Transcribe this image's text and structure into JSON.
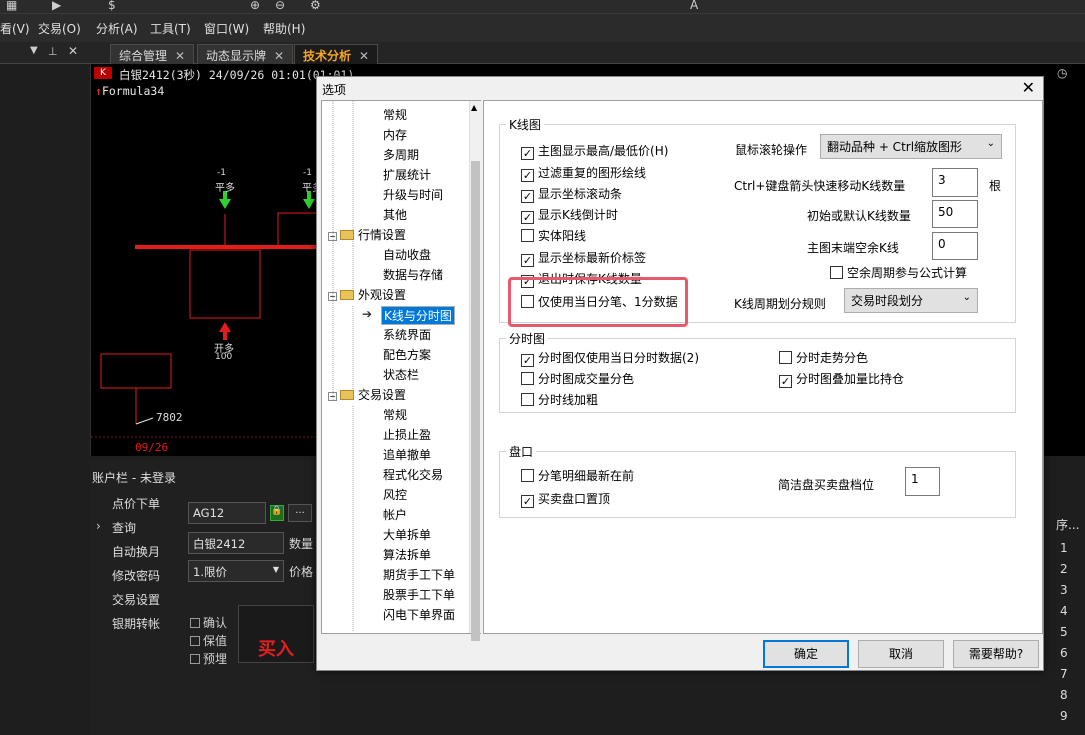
{
  "menubar": [
    "看(V)",
    "交易(O)",
    "分析(A)",
    "工具(T)",
    "窗口(W)",
    "帮助(H)"
  ],
  "tabs": [
    {
      "label": "综合管理",
      "active": false
    },
    {
      "label": "动态显示牌",
      "active": false
    },
    {
      "label": "技术分析",
      "active": true
    }
  ],
  "chart": {
    "info": "白银2412(3秒) 24/09/26 01:01(01:01)",
    "formula": "Formula34",
    "marks": [
      {
        "num": "-1",
        "label": "平多"
      },
      {
        "num": "-1",
        "label": "平多"
      },
      {
        "label": "开多",
        "num": "100"
      }
    ],
    "price": "7802",
    "date": "09/26"
  },
  "account": {
    "title": "账户栏 - 未登录",
    "items": [
      "点价下单",
      "查询",
      "自动换月",
      "修改密码",
      "交易设置",
      "银期转帐"
    ],
    "code": "AG12",
    "name": "白银2412",
    "qty_label": "数量",
    "price_type": "1.限价",
    "price_label": "价格",
    "checks": [
      "确认",
      "保值",
      "预埋"
    ],
    "buy": "买入"
  },
  "rightlist": {
    "header": "序...",
    "rows": [
      "1",
      "2",
      "3",
      "4",
      "5",
      "6",
      "7",
      "8",
      "9"
    ]
  },
  "dialog": {
    "title": "选项",
    "close": "✕",
    "tree": [
      {
        "label": "常规",
        "level": 2
      },
      {
        "label": "内存",
        "level": 2
      },
      {
        "label": "多周期",
        "level": 2
      },
      {
        "label": "扩展统计",
        "level": 2
      },
      {
        "label": "升级与时间",
        "level": 2
      },
      {
        "label": "其他",
        "level": 2
      },
      {
        "label": "行情设置",
        "level": 1
      },
      {
        "label": "自动收盘",
        "level": 2
      },
      {
        "label": "数据与存储",
        "level": 2
      },
      {
        "label": "外观设置",
        "level": 1
      },
      {
        "label": "K线与分时图",
        "level": 2,
        "selected": true
      },
      {
        "label": "系统界面",
        "level": 2
      },
      {
        "label": "配色方案",
        "level": 2
      },
      {
        "label": "状态栏",
        "level": 2
      },
      {
        "label": "交易设置",
        "level": 1
      },
      {
        "label": "常规",
        "level": 2
      },
      {
        "label": "止损止盈",
        "level": 2
      },
      {
        "label": "追单撤单",
        "level": 2
      },
      {
        "label": "程式化交易",
        "level": 2
      },
      {
        "label": "风控",
        "level": 2
      },
      {
        "label": "帐户",
        "level": 2
      },
      {
        "label": "大单拆单",
        "level": 2
      },
      {
        "label": "算法拆单",
        "level": 2
      },
      {
        "label": "期货手工下单",
        "level": 2
      },
      {
        "label": "股票手工下单",
        "level": 2
      },
      {
        "label": "闪电下单界面",
        "level": 2
      }
    ],
    "kline": {
      "group": "K线图",
      "checks": [
        {
          "label": "主图显示最高/最低价(H)",
          "checked": true
        },
        {
          "label": "过滤重复的图形绘线",
          "checked": true
        },
        {
          "label": "显示坐标滚动条",
          "checked": true
        },
        {
          "label": "显示K线倒计时",
          "checked": true
        },
        {
          "label": "实体阳线",
          "checked": false
        },
        {
          "label": "显示坐标最新价标签",
          "checked": true
        },
        {
          "label": "退出时保存K线数量",
          "checked": true
        },
        {
          "label": "仅使用当日分笔、1分数据",
          "checked": false
        }
      ],
      "wheel_label": "鼠标滚轮操作",
      "wheel_value": "翻动品种 + Ctrl缩放图形",
      "ctrl_label": "Ctrl+键盘箭头快速移动K线数量",
      "ctrl_value": "3",
      "ctrl_unit": "根",
      "init_label": "初始或默认K线数量",
      "init_value": "50",
      "tail_label": "主图末端空余K线",
      "tail_value": "0",
      "empty_check": {
        "label": "空余周期参与公式计算",
        "checked": false
      },
      "period_label": "K线周期划分规则",
      "period_value": "交易时段划分"
    },
    "timeshare": {
      "group": "分时图",
      "checks": [
        {
          "label": "分时图仅使用当日分时数据(2)",
          "checked": true
        },
        {
          "label": "分时图成交量分色",
          "checked": false
        },
        {
          "label": "分时线加粗",
          "checked": false
        },
        {
          "label": "分时走势分色",
          "checked": false
        },
        {
          "label": "分时图叠加量比持仓",
          "checked": true
        }
      ]
    },
    "pankou": {
      "group": "盘口",
      "checks": [
        {
          "label": "分笔明细最新在前",
          "checked": false
        },
        {
          "label": "买卖盘口置顶",
          "checked": true
        }
      ],
      "level_label": "简洁盘买卖盘档位",
      "level_value": "1"
    },
    "buttons": {
      "ok": "确定",
      "cancel": "取消",
      "help": "需要帮助?"
    }
  }
}
